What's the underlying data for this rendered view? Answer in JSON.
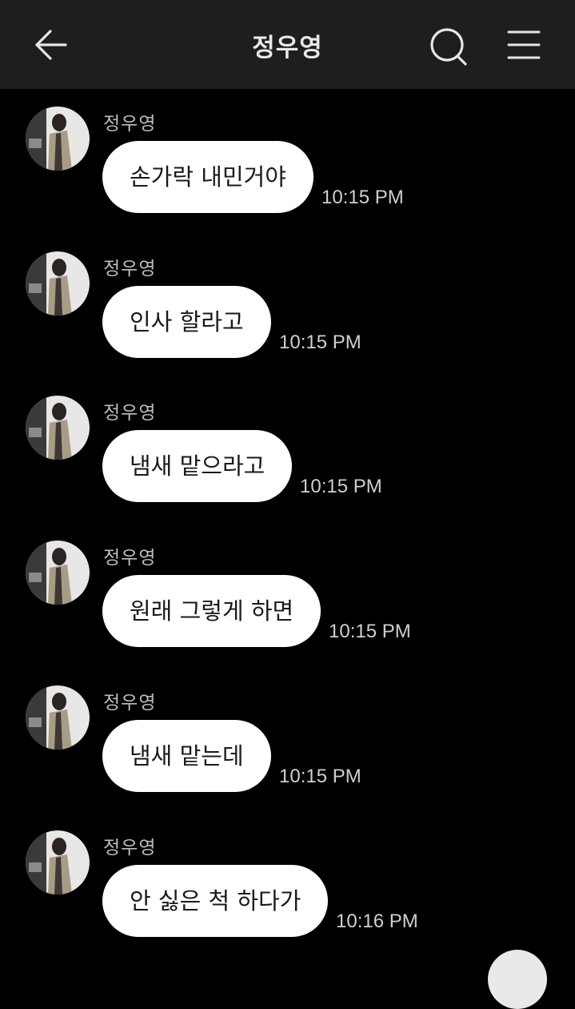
{
  "header": {
    "title": "정우영",
    "back_icon": "arrow-left-icon",
    "search_icon": "search-icon",
    "menu_icon": "hamburger-menu-icon"
  },
  "colors": {
    "background": "#000000",
    "header_background": "#1d1e20",
    "bubble": "#ffffff",
    "bubble_text": "#1a1a1a",
    "meta_text": "#cfcfcf"
  },
  "messages": [
    {
      "sender": "정우영",
      "text": "손가락 내민거야",
      "time": "10:15 PM"
    },
    {
      "sender": "정우영",
      "text": "인사 할라고",
      "time": "10:15 PM"
    },
    {
      "sender": "정우영",
      "text": "냄새 맡으라고",
      "time": "10:15 PM"
    },
    {
      "sender": "정우영",
      "text": "원래 그렇게 하면",
      "time": "10:15 PM"
    },
    {
      "sender": "정우영",
      "text": "냄새 맡는데",
      "time": "10:15 PM"
    },
    {
      "sender": "정우영",
      "text": "안 싫은 척 하다가",
      "time": "10:16 PM"
    }
  ]
}
